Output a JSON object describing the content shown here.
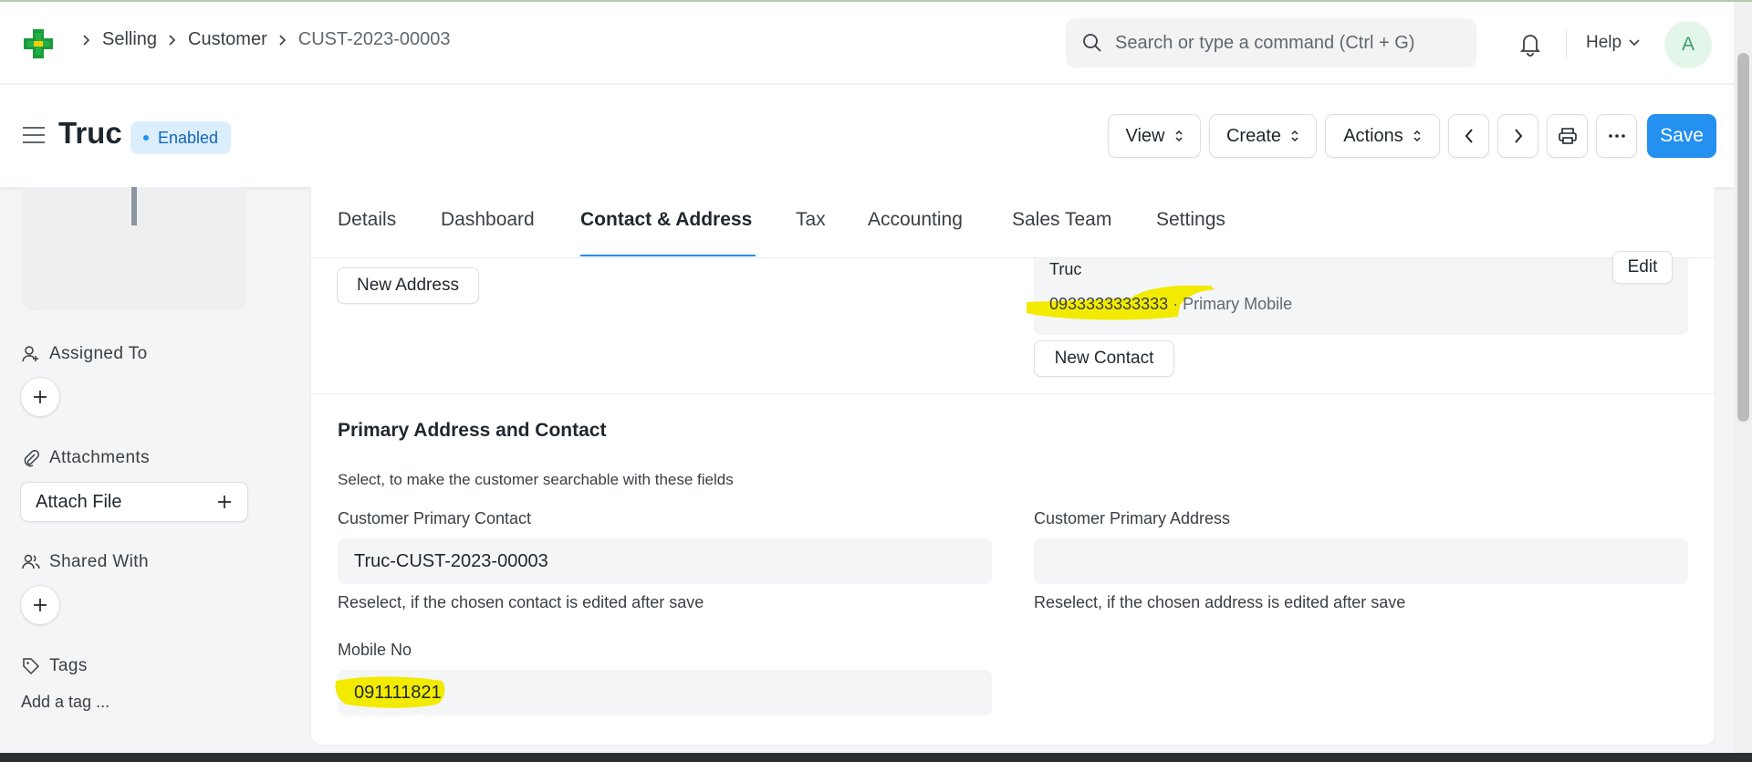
{
  "breadcrumbs": [
    "Selling",
    "Customer",
    "CUST-2023-00003"
  ],
  "search": {
    "placeholder": "Search or type a command (Ctrl + G)"
  },
  "navbar": {
    "help_label": "Help",
    "avatar_initial": "A"
  },
  "page": {
    "title": "Truc",
    "status": "Enabled"
  },
  "toolbar": {
    "view": "View",
    "create": "Create",
    "actions": "Actions",
    "save": "Save"
  },
  "sidebar": {
    "assigned_to": "Assigned To",
    "attachments": "Attachments",
    "attach_file": "Attach File",
    "shared_with": "Shared With",
    "tags": "Tags",
    "add_tag": "Add a tag ..."
  },
  "tabs": [
    {
      "label": "Details"
    },
    {
      "label": "Dashboard"
    },
    {
      "label": "Contact & Address"
    },
    {
      "label": "Tax"
    },
    {
      "label": "Accounting"
    },
    {
      "label": "Sales Team"
    },
    {
      "label": "Settings"
    }
  ],
  "active_tab": "Contact & Address",
  "address": {
    "new_address": "New Address"
  },
  "contact": {
    "name": "Truc",
    "edit": "Edit",
    "phone": "0933333333333",
    "phone_type": "· Primary Mobile",
    "new_contact": "New Contact"
  },
  "primary_section": {
    "title": "Primary Address and Contact",
    "description": "Select, to make the customer searchable with these fields",
    "contact_label": "Customer Primary Contact",
    "contact_value": "Truc-CUST-2023-00003",
    "contact_help": "Reselect, if the chosen contact is edited after save",
    "address_label": "Customer Primary Address",
    "address_value": "",
    "address_help": "Reselect, if the chosen address is edited after save",
    "mobile_label": "Mobile No",
    "mobile_value": "091111821"
  },
  "colors": {
    "primary": "#2490ef",
    "badge_bg": "#dbeefc",
    "highlight": "#f2eb00"
  }
}
